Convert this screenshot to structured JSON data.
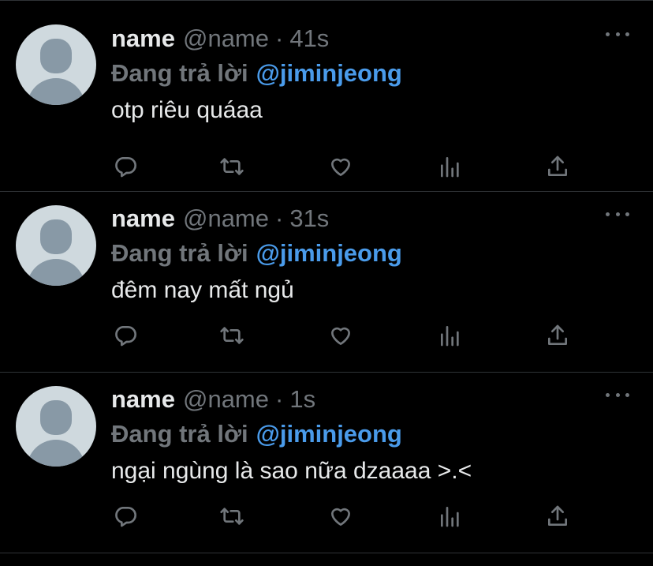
{
  "tweets": [
    {
      "display_name": "name",
      "handle": "@name",
      "separator": "·",
      "time": "41s",
      "reply_prefix": "Đang trả lời",
      "mention": "@jiminjeong",
      "text": "otp riêu quáaa"
    },
    {
      "display_name": "name",
      "handle": "@name",
      "separator": "·",
      "time": "31s",
      "reply_prefix": "Đang trả lời",
      "mention": "@jiminjeong",
      "text": "đêm nay mất ngủ"
    },
    {
      "display_name": "name",
      "handle": "@name",
      "separator": "·",
      "time": "1s",
      "reply_prefix": "Đang trả lời",
      "mention": "@jiminjeong",
      "text": "ngại ngùng là sao nữa dzaaaa >.<"
    }
  ],
  "icons": [
    "more-icon",
    "reply-icon",
    "retweet-icon",
    "like-icon",
    "analytics-icon",
    "share-icon"
  ],
  "colors": {
    "background": "#000000",
    "text": "#e7e9ea",
    "secondary": "#71767b",
    "mention": "#4a9bea",
    "divider": "#2f3336"
  }
}
